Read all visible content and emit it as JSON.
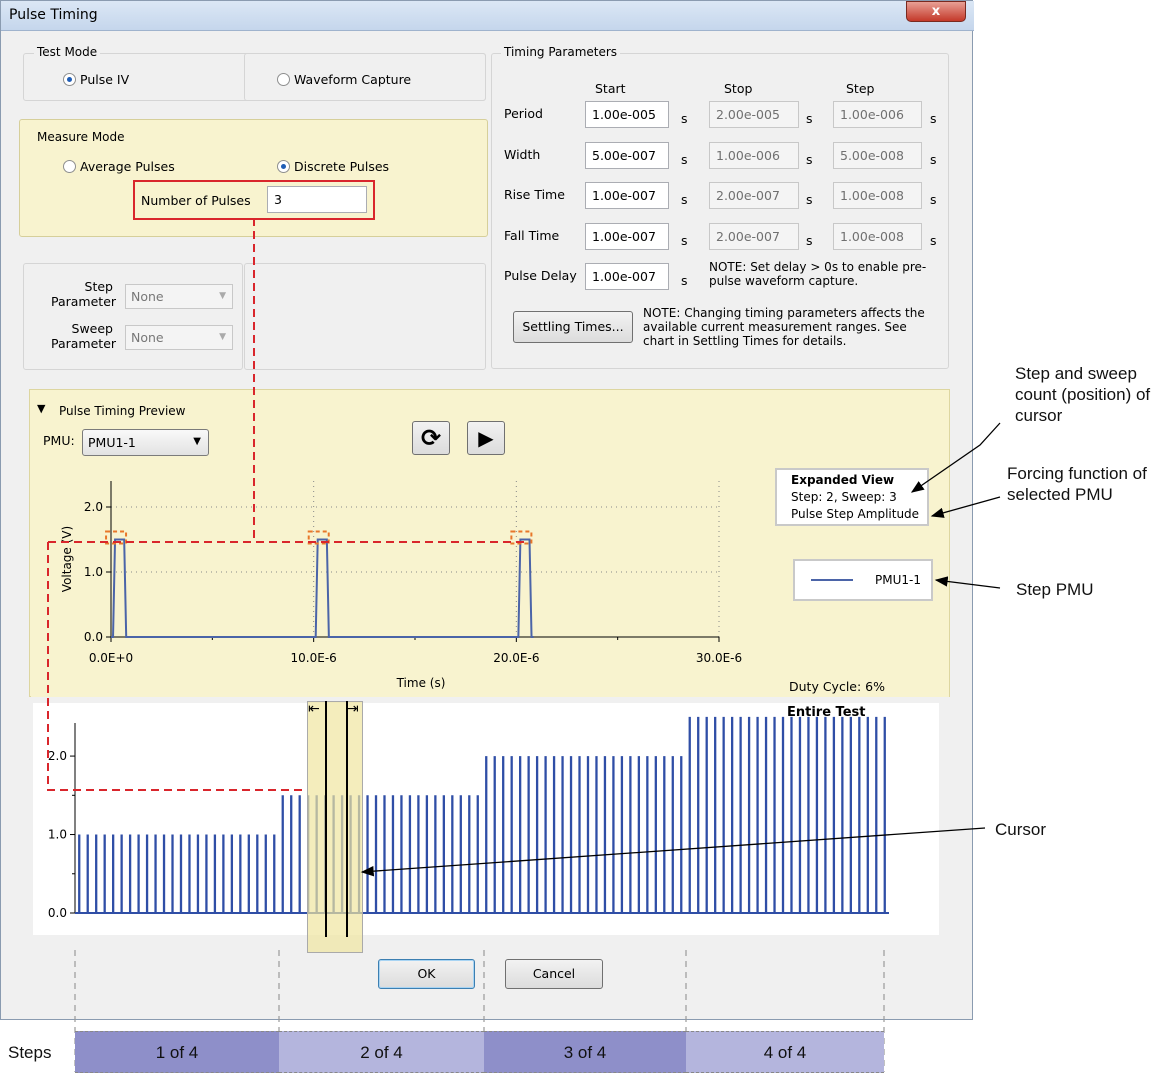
{
  "window": {
    "title": "Pulse Timing",
    "close": "x"
  },
  "test_mode": {
    "label": "Test Mode",
    "options": [
      {
        "label": "Pulse IV",
        "selected": true
      },
      {
        "label": "Waveform Capture",
        "selected": false
      }
    ]
  },
  "measure_mode": {
    "label": "Measure Mode",
    "options": [
      {
        "label": "Average Pulses",
        "selected": false
      },
      {
        "label": "Discrete Pulses",
        "selected": true
      }
    ],
    "num_pulses_label": "Number of Pulses",
    "num_pulses_value": "3"
  },
  "params": {
    "step_label": "Step\nParameter",
    "step_value": "None",
    "sweep_label": "Sweep\nParameter",
    "sweep_value": "None"
  },
  "timing": {
    "label": "Timing Parameters",
    "headers": [
      "Start",
      "Stop",
      "Step"
    ],
    "rows": [
      {
        "label": "Period",
        "start": "1.00e-005",
        "stop": "2.00e-005",
        "step": "1.00e-006",
        "unit": "s"
      },
      {
        "label": "Width",
        "start": "5.00e-007",
        "stop": "1.00e-006",
        "step": "5.00e-008",
        "unit": "s"
      },
      {
        "label": "Rise Time",
        "start": "1.00e-007",
        "stop": "2.00e-007",
        "step": "1.00e-008",
        "unit": "s"
      },
      {
        "label": "Fall Time",
        "start": "1.00e-007",
        "stop": "2.00e-007",
        "step": "1.00e-008",
        "unit": "s"
      },
      {
        "label": "Pulse Delay",
        "start": "1.00e-007",
        "unit": "s"
      }
    ],
    "delay_note": "NOTE: Set delay > 0s to enable pre-pulse waveform capture.",
    "settling_button": "Settling Times...",
    "settling_note": "NOTE: Changing timing parameters affects the available current measurement ranges. See chart in Settling Times for details."
  },
  "preview": {
    "label": "Pulse Timing Preview",
    "pmu_label": "PMU:",
    "pmu_value": "PMU1-1",
    "expanded_title": "Expanded View",
    "expanded_line1": "Step: 2, Sweep: 3",
    "expanded_line2": "Pulse Step Amplitude",
    "legend": "PMU1-1",
    "duty_cycle": "Duty Cycle: 6%",
    "entire_test": "Entire Test"
  },
  "chart_data": [
    {
      "type": "line",
      "title": "Expanded View",
      "xlabel": "Time (s)",
      "ylabel": "Voltage (V)",
      "xticks": [
        "0.0E+0",
        "10.0E-6",
        "20.0E-6",
        "30.0E-6"
      ],
      "yticks": [
        "0.0",
        "1.0",
        "2.0"
      ],
      "xlim": [
        0,
        3e-05
      ],
      "ylim": [
        0,
        2.4
      ],
      "series": [
        {
          "name": "PMU1-1",
          "color": "#4b64a8",
          "x": [
            0,
            1e-07,
            2e-07,
            3e-07,
            5.5e-07,
            6.5e-07,
            7.5e-07,
            8.5e-07,
            1e-05,
            1.01e-05,
            1.02e-05,
            1.03e-05,
            1.055e-05,
            1.065e-05,
            1.075e-05,
            1.085e-05,
            2e-05,
            2.01e-05,
            2.02e-05,
            2.03e-05,
            2.055e-05,
            2.065e-05,
            2.075e-05,
            2.085e-05
          ],
          "y": [
            0,
            0,
            1.5,
            1.5,
            1.5,
            1.5,
            0,
            0,
            0,
            0,
            1.5,
            1.5,
            1.5,
            1.5,
            0,
            0,
            0,
            0,
            1.5,
            1.5,
            1.5,
            1.5,
            0,
            0
          ]
        }
      ]
    },
    {
      "type": "bar",
      "title": "Entire Test",
      "yticks": [
        "0.0",
        "1.0",
        "2.0"
      ],
      "ylim": [
        0,
        2.6
      ],
      "step_levels": [
        1.0,
        1.5,
        2.0,
        2.5
      ],
      "pulses_per_step": 24
    }
  ],
  "buttons": {
    "ok": "OK",
    "cancel": "Cancel"
  },
  "annotations": {
    "cursor_pos": "Step and sweep count (position) of cursor",
    "forcing": "Forcing function of selected PMU",
    "step_pmu": "Step PMU",
    "cursor": "Cursor"
  },
  "steps": {
    "label": "Steps",
    "cells": [
      "1 of 4",
      "2 of 4",
      "3 of 4",
      "4 of 4"
    ],
    "colors": [
      "#8e8fc9",
      "#b4b5dd",
      "#8e8fc9",
      "#b4b5dd"
    ]
  }
}
